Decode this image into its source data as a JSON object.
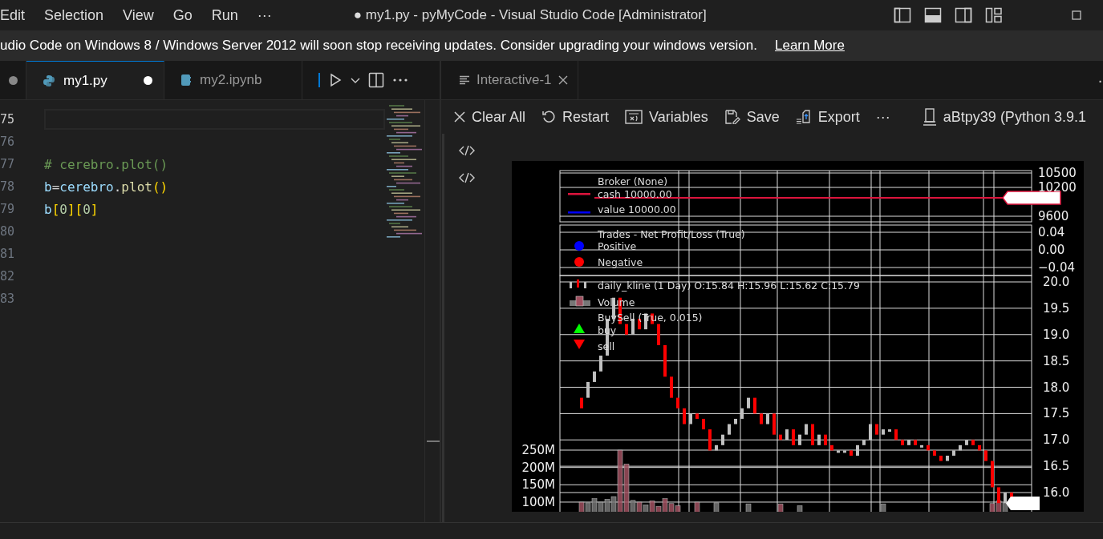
{
  "menu": [
    "Edit",
    "Selection",
    "View",
    "Go",
    "Run",
    "···"
  ],
  "window": {
    "title": "● my1.py - pyMyCode - Visual Studio Code [Administrator]"
  },
  "banner": {
    "text": "udio Code on Windows 8 / Windows Server 2012 will soon stop receiving updates. Consider upgrading your windows version.",
    "link": "Learn More"
  },
  "editor_tabs": [
    {
      "label": "my1.py",
      "kind": "python",
      "selected": true,
      "dirty": true
    },
    {
      "label": "my2.ipynb",
      "kind": "notebook",
      "selected": false,
      "dirty": false
    }
  ],
  "editor": {
    "lines": [
      {
        "number": "75",
        "current": true
      },
      {
        "number": "76",
        "current": false
      },
      {
        "number": "77",
        "current": false,
        "tokens": [
          {
            "text": "# cerebro.plot()",
            "kind": "comment"
          }
        ]
      },
      {
        "number": "78",
        "current": false,
        "tokens": [
          {
            "text": "b",
            "kind": "var"
          },
          {
            "text": "=",
            "kind": "op"
          },
          {
            "text": "cerebro",
            "kind": "var"
          },
          {
            "text": ".",
            "kind": "op"
          },
          {
            "text": "plot",
            "kind": "func"
          },
          {
            "text": "()",
            "kind": "bracket"
          }
        ]
      },
      {
        "number": "79",
        "current": false,
        "tokens": [
          {
            "text": "b",
            "kind": "var"
          },
          {
            "text": "[",
            "kind": "bracket"
          },
          {
            "text": "0",
            "kind": "num"
          },
          {
            "text": "]",
            "kind": "bracket"
          },
          {
            "text": "[",
            "kind": "bracket"
          },
          {
            "text": "0",
            "kind": "num"
          },
          {
            "text": "]",
            "kind": "bracket"
          }
        ]
      },
      {
        "number": "80",
        "current": false
      },
      {
        "number": "81",
        "current": false
      },
      {
        "number": "82",
        "current": false
      },
      {
        "number": "83",
        "current": false
      }
    ]
  },
  "interactive_tab": {
    "label": "Interactive-1",
    "more": "·"
  },
  "toolbar": [
    {
      "label": "Clear All",
      "kind": "close"
    },
    {
      "label": "Restart",
      "kind": "restart"
    },
    {
      "label": "Variables",
      "kind": "variables"
    },
    {
      "label": "Save",
      "kind": "save"
    },
    {
      "label": "Export",
      "kind": "export"
    },
    {
      "label": "···",
      "kind": "more"
    },
    {
      "label": "aBtpy39 (Python 3.9.1",
      "kind": "kernel"
    }
  ],
  "plot": {
    "broker_panel": {
      "legend": [
        {
          "label": "Broker (None)",
          "kind": "title"
        },
        {
          "label": "cash 10000.00",
          "kind": "line",
          "color": "#dc143c"
        },
        {
          "label": "value 10000.00",
          "kind": "line",
          "color": "#0000ff"
        }
      ],
      "yticks": [
        "10500",
        "10200",
        "9600"
      ]
    },
    "trades_panel": {
      "legend": [
        {
          "label": "Trades - Net Profit/Loss (True)",
          "kind": "title"
        },
        {
          "label": "Positive",
          "kind": "circle",
          "color": "#0000ff"
        },
        {
          "label": "Negative",
          "kind": "circle",
          "color": "#ff0000"
        }
      ],
      "yticks": [
        "0.04",
        "0.00",
        "−0.04"
      ]
    },
    "price_panel": {
      "legend": [
        {
          "label": "daily_kline (1 Day) O:15.84 H:15.96 L:15.62 C:15.79",
          "kind": "candle"
        },
        {
          "label": "Volume",
          "kind": "bar"
        },
        {
          "label": "BuySell (True, 0.015)",
          "kind": "title"
        },
        {
          "label": "buy",
          "kind": "up",
          "color": "#00ff00"
        },
        {
          "label": "sell",
          "kind": "down",
          "color": "#ff0000"
        }
      ],
      "yticks": [
        "20.0",
        "19.5",
        "19.0",
        "18.5",
        "18.0",
        "17.5",
        "17.0",
        "16.5",
        "16.0"
      ]
    },
    "volume_panel": {
      "yticks": [
        "250M",
        "200M",
        "150M",
        "100M"
      ]
    }
  }
}
